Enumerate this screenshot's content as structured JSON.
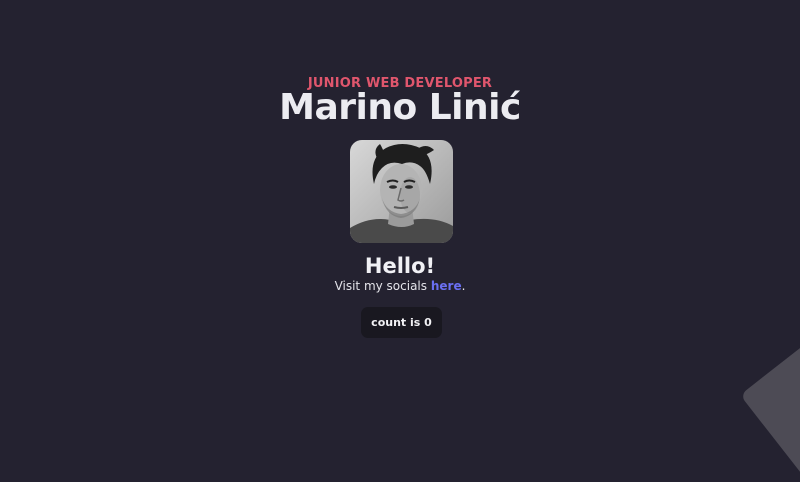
{
  "header": {
    "subtitle": "JUNIOR WEB DEVELOPER",
    "name": "Marino Linić"
  },
  "profile": {
    "avatar_alt": "Portrait of Marino Linić"
  },
  "greeting": {
    "title": "Hello!",
    "socials_prefix": "Visit my socials ",
    "socials_link": "here",
    "socials_suffix": "."
  },
  "counter": {
    "label": "count is 0"
  },
  "colors": {
    "background": "#242230",
    "accent": "#e0566d",
    "link": "#6a6ff2",
    "button_bg": "#191820"
  }
}
